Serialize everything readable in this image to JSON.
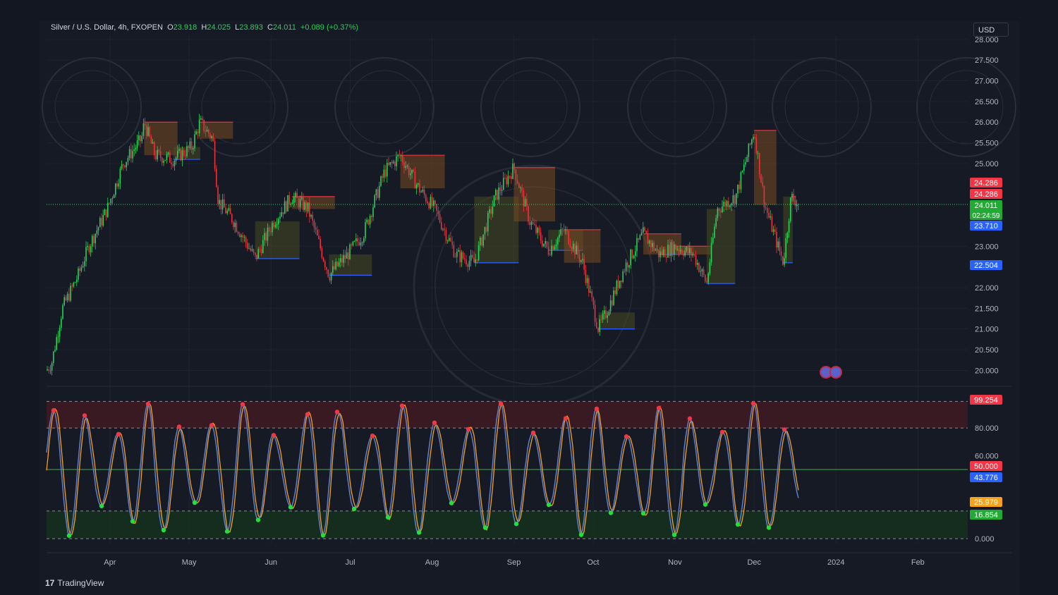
{
  "header": {
    "symbol": "Silver / U.S. Dollar, 4h, FXOPEN",
    "open_label": "O",
    "open": "23.918",
    "high_label": "H",
    "high": "24.025",
    "low_label": "L",
    "low": "23.893",
    "close_label": "C",
    "close": "24.011",
    "change": "+0.089 (+0.37%)"
  },
  "currency_button": "USD",
  "branding": {
    "logo_icon": "tradingview-logo-icon",
    "name": "TradingView"
  },
  "colors": {
    "background": "#161a25",
    "up": "#26d35a",
    "down": "#ef2f3c",
    "resistance_fill": "#7a4a22",
    "support_fill": "#4a4a22",
    "support_line": "#2962ff",
    "osc_line": "#5b7fd6",
    "osc_signal": "#f7a21b",
    "overbought_zone": "#3d1a22",
    "oversold_zone": "#15301f"
  },
  "price_labels": [
    {
      "text": "24.286",
      "color": "#f23645"
    },
    {
      "text": "24.286",
      "color": "#f23645"
    },
    {
      "text": "24.011",
      "sub": "02:24:59",
      "color": "#22ab34"
    },
    {
      "text": "23.710",
      "color": "#2962ff"
    },
    {
      "text": "22.504",
      "color": "#2962ff"
    }
  ],
  "osc_labels": [
    {
      "text": "99.254",
      "color": "#f23645"
    },
    {
      "text": "50.000",
      "color": "#f23645"
    },
    {
      "text": "43.776",
      "color": "#2962ff"
    },
    {
      "text": "25.979",
      "color": "#f7a21b"
    },
    {
      "text": "16.854",
      "color": "#22ab34"
    }
  ],
  "chart_data": [
    {
      "type": "candlestick",
      "title": "Silver / U.S. Dollar, 4h, FXOPEN",
      "y_ticks": [
        "28.000",
        "27.500",
        "27.000",
        "26.500",
        "26.000",
        "25.500",
        "25.000",
        "23.000",
        "22.000",
        "21.500",
        "21.000",
        "20.500",
        "20.000"
      ],
      "ylim": [
        19.75,
        28.1
      ],
      "x_ticks": [
        "Apr",
        "May",
        "Jun",
        "Jul",
        "Aug",
        "Sep",
        "Oct",
        "Nov",
        "Dec",
        "2024",
        "Feb"
      ],
      "x_tick_dates": [
        "2023-04-01",
        "2023-05-01",
        "2023-06-01",
        "2023-07-01",
        "2023-08-01",
        "2023-09-01",
        "2023-10-01",
        "2023-11-01",
        "2023-12-01",
        "2024-01-01",
        "2024-02-01"
      ],
      "last_price": 24.011,
      "price_path": [
        {
          "date": "2023-03-08",
          "price": 20.0
        },
        {
          "date": "2023-03-10",
          "price": 20.2
        },
        {
          "date": "2023-03-14",
          "price": 21.5
        },
        {
          "date": "2023-03-20",
          "price": 22.3
        },
        {
          "date": "2023-03-24",
          "price": 23.0
        },
        {
          "date": "2023-03-31",
          "price": 23.9
        },
        {
          "date": "2023-04-06",
          "price": 25.0
        },
        {
          "date": "2023-04-13",
          "price": 25.6
        },
        {
          "date": "2023-04-14",
          "price": 26.0
        },
        {
          "date": "2023-04-18",
          "price": 25.2
        },
        {
          "date": "2023-04-25",
          "price": 25.1
        },
        {
          "date": "2023-05-02",
          "price": 25.4
        },
        {
          "date": "2023-05-05",
          "price": 26.0
        },
        {
          "date": "2023-05-10",
          "price": 25.6
        },
        {
          "date": "2023-05-12",
          "price": 24.1
        },
        {
          "date": "2023-05-18",
          "price": 23.6
        },
        {
          "date": "2023-05-26",
          "price": 22.7
        },
        {
          "date": "2023-06-02",
          "price": 23.6
        },
        {
          "date": "2023-06-09",
          "price": 24.2
        },
        {
          "date": "2023-06-15",
          "price": 23.9
        },
        {
          "date": "2023-06-23",
          "price": 22.3
        },
        {
          "date": "2023-06-30",
          "price": 22.8
        },
        {
          "date": "2023-07-06",
          "price": 23.3
        },
        {
          "date": "2023-07-14",
          "price": 24.8
        },
        {
          "date": "2023-07-20",
          "price": 25.2
        },
        {
          "date": "2023-07-27",
          "price": 24.4
        },
        {
          "date": "2023-08-02",
          "price": 23.9
        },
        {
          "date": "2023-08-10",
          "price": 22.8
        },
        {
          "date": "2023-08-17",
          "price": 22.6
        },
        {
          "date": "2023-08-25",
          "price": 24.2
        },
        {
          "date": "2023-09-01",
          "price": 24.9
        },
        {
          "date": "2023-09-07",
          "price": 23.6
        },
        {
          "date": "2023-09-14",
          "price": 22.9
        },
        {
          "date": "2023-09-20",
          "price": 23.4
        },
        {
          "date": "2023-09-27",
          "price": 22.6
        },
        {
          "date": "2023-10-03",
          "price": 21.0
        },
        {
          "date": "2023-10-06",
          "price": 21.4
        },
        {
          "date": "2023-10-13",
          "price": 22.5
        },
        {
          "date": "2023-10-20",
          "price": 23.3
        },
        {
          "date": "2023-10-26",
          "price": 22.8
        },
        {
          "date": "2023-11-01",
          "price": 23.0
        },
        {
          "date": "2023-11-08",
          "price": 22.8
        },
        {
          "date": "2023-11-13",
          "price": 22.1
        },
        {
          "date": "2023-11-17",
          "price": 23.9
        },
        {
          "date": "2023-11-24",
          "price": 24.2
        },
        {
          "date": "2023-11-28",
          "price": 25.1
        },
        {
          "date": "2023-12-01",
          "price": 25.8
        },
        {
          "date": "2023-12-05",
          "price": 24.0
        },
        {
          "date": "2023-12-08",
          "price": 23.4
        },
        {
          "date": "2023-12-12",
          "price": 22.6
        },
        {
          "date": "2023-12-15",
          "price": 24.2
        },
        {
          "date": "2023-12-18",
          "price": 24.011
        }
      ]
    },
    {
      "type": "line",
      "title": "",
      "y_ticks": [
        "80.000",
        "60.000",
        "0.000"
      ],
      "ylim": [
        -3,
        103
      ],
      "levels": [
        99.254,
        80,
        50,
        20,
        0
      ],
      "series": [
        {
          "values_last": 43.776
        },
        {
          "values_last": 25.979
        }
      ]
    }
  ]
}
